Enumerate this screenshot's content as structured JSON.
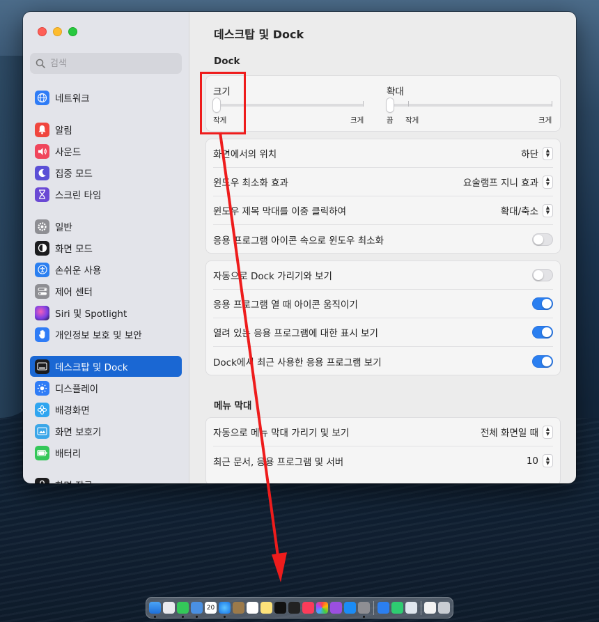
{
  "sidebar": {
    "search_placeholder": "검색",
    "items": [
      {
        "label": "네트워크",
        "icon": "globe-icon",
        "color": "#2f7cf6"
      },
      {
        "label": "알림",
        "icon": "bell-icon",
        "color": "#f0463e"
      },
      {
        "label": "사운드",
        "icon": "speaker-icon",
        "color": "#f0465c"
      },
      {
        "label": "집중 모드",
        "icon": "moon-icon",
        "color": "#5b4fd6"
      },
      {
        "label": "스크린 타임",
        "icon": "hourglass-icon",
        "color": "#6a49d4"
      },
      {
        "label": "일반",
        "icon": "gear-icon",
        "color": "#8e8e93"
      },
      {
        "label": "화면 모드",
        "icon": "appearance-icon",
        "color": "#1c1c1e"
      },
      {
        "label": "손쉬운 사용",
        "icon": "accessibility-icon",
        "color": "#2b7ff0"
      },
      {
        "label": "제어 센터",
        "icon": "control-center-icon",
        "color": "#8e8e93"
      },
      {
        "label": "Siri 및 Spotlight",
        "icon": "siri-icon",
        "color": "#c0349e"
      },
      {
        "label": "개인정보 보호 및 보안",
        "icon": "hand-icon",
        "color": "#2f7cf6"
      },
      {
        "label": "데스크탑 및 Dock",
        "icon": "dock-icon",
        "color": "#1c1c1e"
      },
      {
        "label": "디스플레이",
        "icon": "sun-icon",
        "color": "#2f7cf6"
      },
      {
        "label": "배경화면",
        "icon": "flower-icon",
        "color": "#2fa5f0"
      },
      {
        "label": "화면 보호기",
        "icon": "screensaver-icon",
        "color": "#3aa6e8"
      },
      {
        "label": "배터리",
        "icon": "battery-icon",
        "color": "#34c759"
      },
      {
        "label": "화면 잠금",
        "icon": "lock-icon",
        "color": "#1c1c1e"
      }
    ]
  },
  "main": {
    "title": "데스크탑 및 Dock",
    "dock_section": "Dock",
    "size_slider": {
      "label": "크기",
      "min_label": "작게",
      "max_label": "크게",
      "value": 0.0
    },
    "magnify_slider": {
      "label": "확대",
      "off_label": "끔",
      "min_label": "작게",
      "max_label": "크게",
      "value": 0.0
    },
    "rows1": [
      {
        "label": "화면에서의 위치",
        "value": "하단"
      },
      {
        "label": "윈도우 최소화 효과",
        "value": "요술램프 지니 효과"
      },
      {
        "label": "윈도우 제목 막대를 이중 클릭하여",
        "value": "확대/축소"
      },
      {
        "label": "응용 프로그램 아이콘 속으로 윈도우 최소화"
      }
    ],
    "rows2": [
      {
        "label": "자동으로 Dock 가리기와 보기"
      },
      {
        "label": "응용 프로그램 열 때 아이콘 움직이기"
      },
      {
        "label": "열려 있는 응용 프로그램에 대한 표시 보기"
      },
      {
        "label": "Dock에서 최근 사용한 응용 프로그램 보기"
      }
    ],
    "menu_section": "메뉴 막대",
    "rows3": [
      {
        "label": "자동으로 메뉴 막대 가리기 및 보기",
        "value": "전체 화면일 때"
      },
      {
        "label": "최근 문서, 응용 프로그램 및 서버",
        "value": "10"
      }
    ]
  },
  "toggles": {
    "minimize_into_icon": false,
    "auto_hide_dock": false,
    "animate_opening": true,
    "show_indicators": true,
    "show_recent": true
  },
  "dock_calendar_day": "20",
  "colors": {
    "accent": "#1a67d3",
    "annotation": "#ee1c1c"
  }
}
